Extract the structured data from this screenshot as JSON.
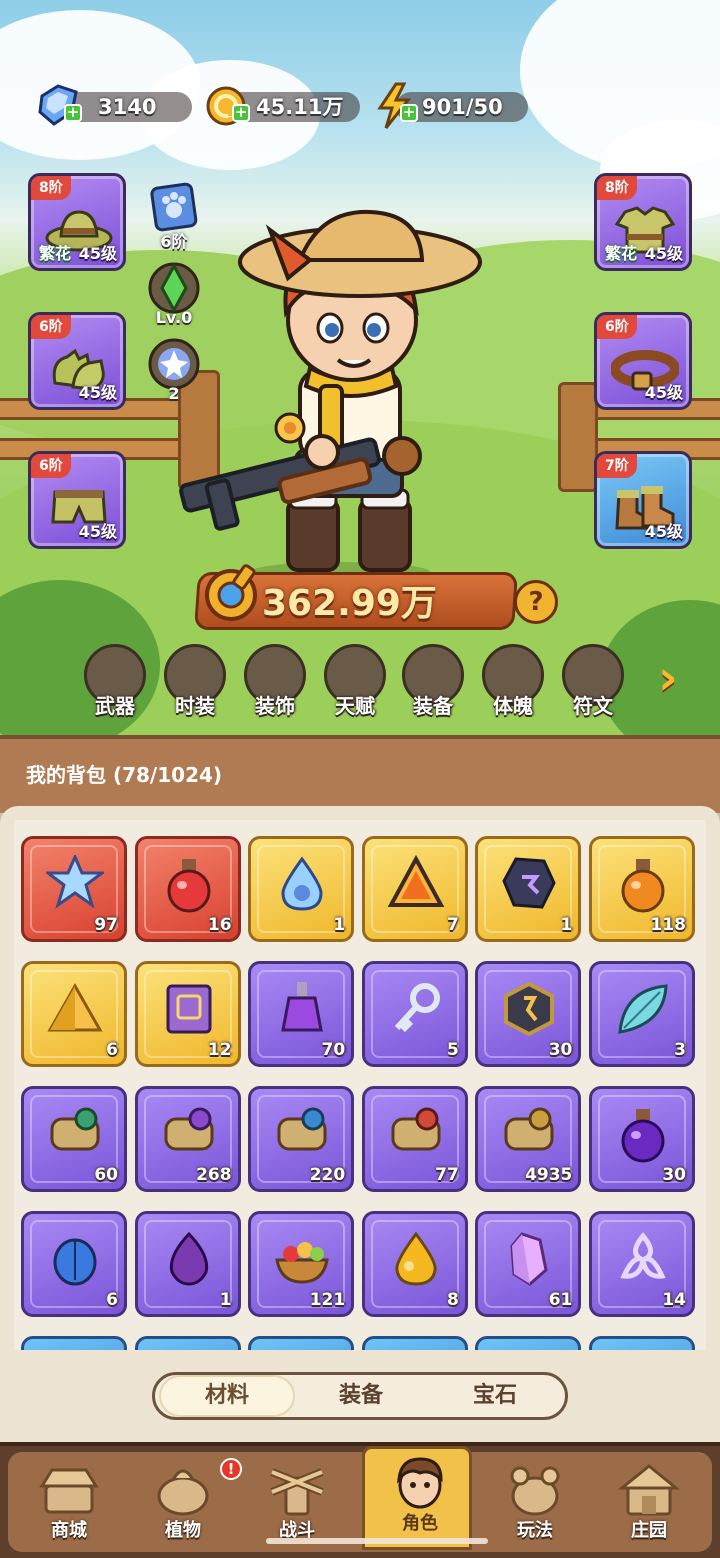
{
  "resources": {
    "diamonds": "3140",
    "gold": "45.11万",
    "energy": "901/50"
  },
  "left_slots": [
    {
      "tier": "8阶",
      "prefix": "繁花",
      "level": "45级",
      "icon": "hat-icon"
    },
    {
      "tier": "6阶",
      "prefix": "",
      "level": "45级",
      "icon": "gloves-icon"
    },
    {
      "tier": "6阶",
      "prefix": "",
      "level": "45级",
      "icon": "pants-icon"
    }
  ],
  "right_slots": [
    {
      "tier": "8阶",
      "prefix": "繁花",
      "level": "45级",
      "icon": "shirt-icon"
    },
    {
      "tier": "6阶",
      "prefix": "",
      "level": "45级",
      "icon": "belt-icon"
    },
    {
      "tier": "7阶",
      "prefix": "",
      "level": "45级",
      "icon": "boots-icon"
    }
  ],
  "mini_items": [
    {
      "label": "6阶",
      "icon": "paw-card-icon"
    },
    {
      "label": "Lv.0",
      "icon": "green-gem-icon"
    },
    {
      "label": "2",
      "icon": "star-orb-icon"
    }
  ],
  "power": "362.99万",
  "features": [
    "武器",
    "时装",
    "装饰",
    "天赋",
    "装备",
    "体魄",
    "符文"
  ],
  "bag": {
    "title": "我的背包 (78/1024)",
    "items": [
      {
        "rarity": "red",
        "count": "97",
        "icon": "crystal-star-icon"
      },
      {
        "rarity": "red",
        "count": "16",
        "icon": "red-potion-icon"
      },
      {
        "rarity": "gold",
        "count": "1",
        "icon": "water-drop-icon"
      },
      {
        "rarity": "gold",
        "count": "7",
        "icon": "prism-icon"
      },
      {
        "rarity": "gold",
        "count": "1",
        "icon": "rune-stone-icon"
      },
      {
        "rarity": "gold",
        "count": "118",
        "icon": "orange-potion-icon"
      },
      {
        "rarity": "gold",
        "count": "6",
        "icon": "gold-pyramid-icon"
      },
      {
        "rarity": "gold",
        "count": "12",
        "icon": "spellbook-icon"
      },
      {
        "rarity": "purple",
        "count": "70",
        "icon": "purple-potion-icon"
      },
      {
        "rarity": "purple",
        "count": "5",
        "icon": "key-icon"
      },
      {
        "rarity": "purple",
        "count": "30",
        "icon": "gold-rune-icon"
      },
      {
        "rarity": "purple",
        "count": "3",
        "icon": "leaf-icon"
      },
      {
        "rarity": "purple",
        "count": "60",
        "icon": "scroll-green-icon"
      },
      {
        "rarity": "purple",
        "count": "268",
        "icon": "scroll-purple-icon"
      },
      {
        "rarity": "purple",
        "count": "220",
        "icon": "scroll-blue-icon"
      },
      {
        "rarity": "purple",
        "count": "77",
        "icon": "scroll-red-icon"
      },
      {
        "rarity": "purple",
        "count": "4935",
        "icon": "scroll-gold-icon"
      },
      {
        "rarity": "purple",
        "count": "30",
        "icon": "violet-potion-icon"
      },
      {
        "rarity": "purple",
        "count": "6",
        "icon": "blue-seed-icon"
      },
      {
        "rarity": "purple",
        "count": "1",
        "icon": "onion-icon"
      },
      {
        "rarity": "purple",
        "count": "121",
        "icon": "fruit-bowl-icon"
      },
      {
        "rarity": "purple",
        "count": "8",
        "icon": "honey-drop-icon"
      },
      {
        "rarity": "purple",
        "count": "61",
        "icon": "pink-crystal-icon"
      },
      {
        "rarity": "purple",
        "count": "14",
        "icon": "knot-icon"
      }
    ]
  },
  "tabs": [
    "材料",
    "装备",
    "宝石"
  ],
  "active_tab": "材料",
  "nav": [
    {
      "label": "商城",
      "icon": "shop-icon"
    },
    {
      "label": "植物",
      "icon": "plant-icon",
      "badge": "!"
    },
    {
      "label": "战斗",
      "icon": "battle-icon"
    },
    {
      "label": "角色",
      "icon": "character-icon"
    },
    {
      "label": "玩法",
      "icon": "gameplay-icon"
    },
    {
      "label": "庄园",
      "icon": "manor-icon"
    }
  ],
  "colors": {
    "rarity_red": "#d8412f",
    "rarity_gold": "#f0b72b",
    "rarity_purple": "#7a55d8",
    "rarity_blue": "#3a86d8",
    "wood": "#9c6c49"
  }
}
